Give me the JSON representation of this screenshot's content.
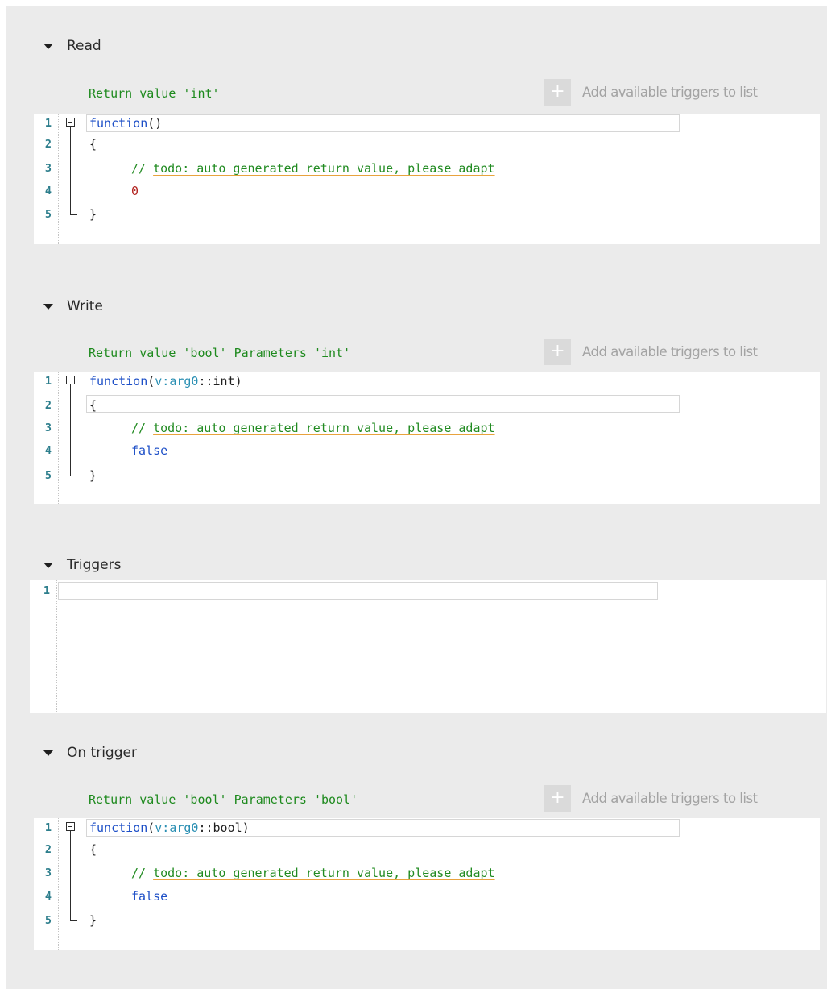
{
  "sections": [
    {
      "title": "Read",
      "return_label": "Return value 'int'",
      "add_triggers_label": "Add available triggers to list",
      "add_icon": "plus-icon",
      "code": {
        "line_numbers": [
          "1",
          "2",
          "3",
          "4",
          "5"
        ],
        "signature_keyword": "function",
        "signature_open": "(",
        "signature_params": "",
        "signature_close": ")",
        "open_brace": "{",
        "comment_prefix": "// ",
        "comment_text": "todo: auto generated return value, please adapt",
        "return_value": "0",
        "close_brace": "}"
      }
    },
    {
      "title": "Write",
      "return_label": "Return value 'bool' Parameters 'int'",
      "add_triggers_label": "Add available triggers to list",
      "add_icon": "plus-icon",
      "code": {
        "line_numbers": [
          "1",
          "2",
          "3",
          "4",
          "5"
        ],
        "signature_keyword": "function",
        "signature_open": "(",
        "signature_param_name": "v:arg0",
        "signature_param_type": "::int",
        "signature_close": ")",
        "open_brace": "{",
        "comment_prefix": "// ",
        "comment_text": "todo: auto generated return value, please adapt",
        "return_value": "false",
        "close_brace": "}"
      }
    },
    {
      "title": "Triggers",
      "code": {
        "line_numbers": [
          "1"
        ]
      }
    },
    {
      "title": "On trigger",
      "return_label": "Return value 'bool' Parameters 'bool'",
      "add_triggers_label": "Add available triggers to list",
      "add_icon": "plus-icon",
      "code": {
        "line_numbers": [
          "1",
          "2",
          "3",
          "4",
          "5"
        ],
        "signature_keyword": "function",
        "signature_open": "(",
        "signature_param_name": "v:arg0",
        "signature_param_type": "::bool",
        "signature_close": ")",
        "open_brace": "{",
        "comment_prefix": "// ",
        "comment_text": "todo: auto generated return value, please adapt",
        "return_value": "false",
        "close_brace": "}"
      }
    }
  ],
  "icons": {
    "section_toggle": "triangle-down-icon",
    "fold": "fold-minus-icon"
  },
  "colors": {
    "panel_background": "#ebebeb",
    "return_label": "#1e8a1e",
    "keyword": "#1d4fc7",
    "parameter": "#2a8fb3",
    "number": "#b2231f",
    "comment": "#218b21",
    "todo_underline": "#e8a33d",
    "line_number": "#2d7e8c",
    "add_text": "#a3a3a3"
  }
}
